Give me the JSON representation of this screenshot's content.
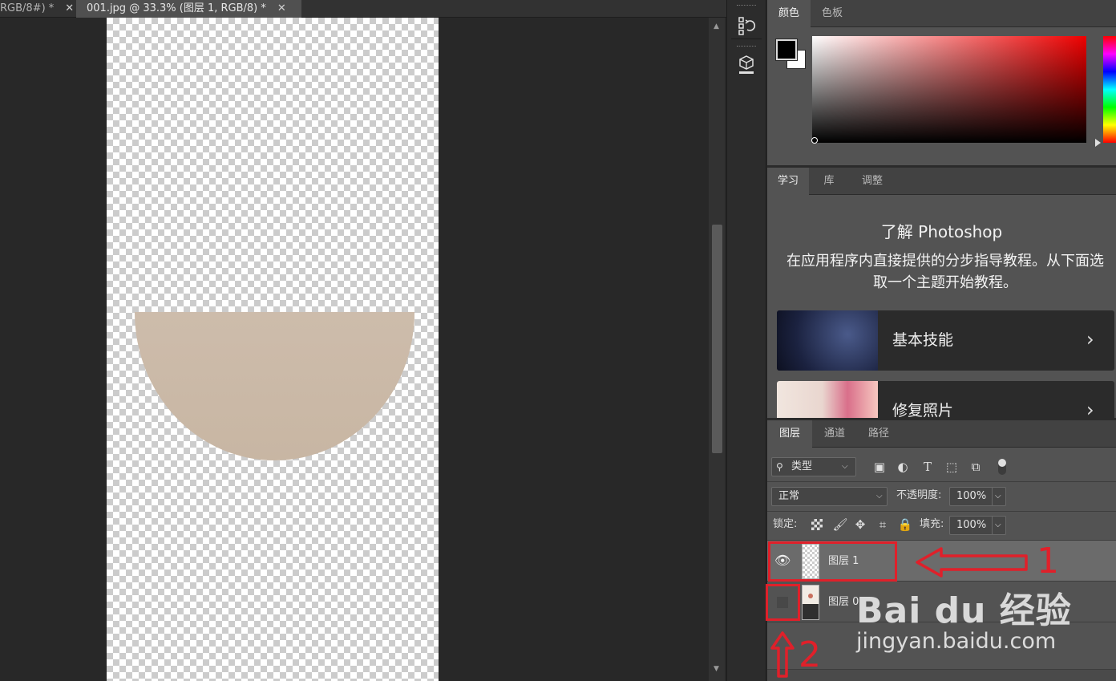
{
  "tabs": [
    {
      "label": "RGB/8#) *",
      "close": "✕"
    },
    {
      "label": "001.jpg @ 33.3% (图层 1, RGB/8) *",
      "close": "✕"
    }
  ],
  "color_panel": {
    "tabs": [
      "颜色",
      "色板"
    ],
    "fg_color": "#000000",
    "bg_color": "#ffffff",
    "field_hue": "#ee0000"
  },
  "learn_panel": {
    "tabs": [
      "学习",
      "库",
      "调整"
    ],
    "title": "了解 Photoshop",
    "description": "在应用程序内直接提供的分步指导教程。从下面选取一个主题开始教程。",
    "cards": [
      {
        "label": "基本技能",
        "chevron": "›"
      },
      {
        "label": "修复照片",
        "chevron": "›"
      }
    ]
  },
  "layers_panel": {
    "tabs": [
      "图层",
      "通道",
      "路径"
    ],
    "filter_kind": "类型",
    "blend_mode": "正常",
    "opacity_label": "不透明度:",
    "opacity_value": "100%",
    "lock_label": "锁定:",
    "fill_label": "填充:",
    "fill_value": "100%",
    "layers": [
      {
        "name": "图层 1",
        "visible": true,
        "selected": true
      },
      {
        "name": "图层 0",
        "visible": false,
        "selected": false
      }
    ]
  },
  "annotations": {
    "arrow1_number": "1",
    "arrow2_number": "2",
    "highlight_color": "#e0202a"
  },
  "watermark": {
    "brand": "Bai du 经验",
    "url": "jingyan.baidu.com"
  }
}
